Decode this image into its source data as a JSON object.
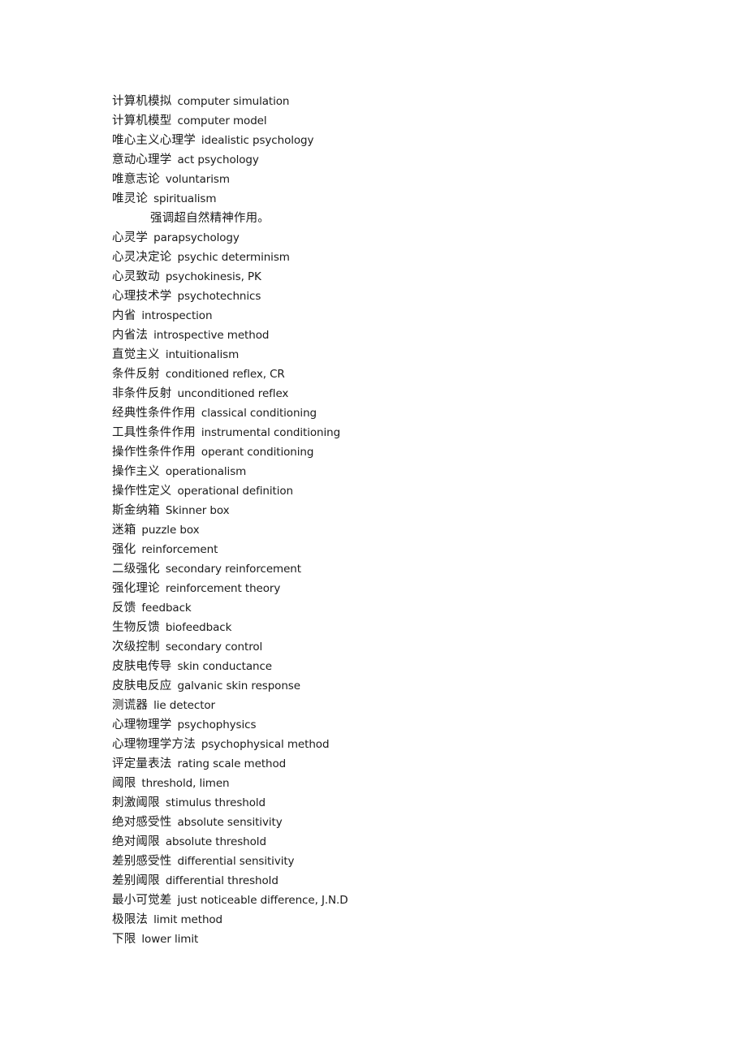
{
  "document": {
    "type": "glossary",
    "language": "zh-CN / en",
    "subject": "psychology-terminology-list",
    "background_color": "#ffffff",
    "text_color": "#1a1a1a"
  },
  "entries": [
    {
      "term": "计算机模拟",
      "gloss": "computer simulation",
      "note": false
    },
    {
      "term": "计算机模型",
      "gloss": "computer model",
      "note": false
    },
    {
      "term": "唯心主义心理学",
      "gloss": "idealistic psychology",
      "note": false
    },
    {
      "term": "意动心理学",
      "gloss": "act psychology",
      "note": false
    },
    {
      "term": "唯意志论",
      "gloss": "voluntarism",
      "note": false
    },
    {
      "term": "唯灵论",
      "gloss": "spiritualism",
      "note": false
    },
    {
      "term": "强调超自然精神作用。",
      "gloss": "",
      "note": true
    },
    {
      "term": "心灵学",
      "gloss": "parapsychology",
      "note": false
    },
    {
      "term": "心灵决定论",
      "gloss": "psychic determinism",
      "note": false
    },
    {
      "term": "心灵致动",
      "gloss": "psychokinesis, PK",
      "note": false
    },
    {
      "term": "心理技术学",
      "gloss": "psychotechnics",
      "note": false
    },
    {
      "term": "内省",
      "gloss": "introspection",
      "note": false
    },
    {
      "term": "内省法",
      "gloss": "introspective method",
      "note": false
    },
    {
      "term": "直觉主义",
      "gloss": "intuitionalism",
      "note": false
    },
    {
      "term": "条件反射",
      "gloss": "conditioned reflex, CR",
      "note": false
    },
    {
      "term": "非条件反射",
      "gloss": "unconditioned reflex",
      "note": false
    },
    {
      "term": "经典性条件作用",
      "gloss": "classical conditioning",
      "note": false
    },
    {
      "term": "工具性条件作用",
      "gloss": "instrumental conditioning",
      "note": false
    },
    {
      "term": "操作性条件作用",
      "gloss": "operant conditioning",
      "note": false
    },
    {
      "term": "操作主义",
      "gloss": "operationalism",
      "note": false
    },
    {
      "term": "操作性定义",
      "gloss": "operational definition",
      "note": false
    },
    {
      "term": "斯金纳箱",
      "gloss": "Skinner box",
      "note": false
    },
    {
      "term": "迷箱",
      "gloss": "puzzle box",
      "note": false
    },
    {
      "term": "强化",
      "gloss": "reinforcement",
      "note": false
    },
    {
      "term": "二级强化",
      "gloss": "secondary reinforcement",
      "note": false
    },
    {
      "term": "强化理论",
      "gloss": "reinforcement theory",
      "note": false
    },
    {
      "term": "反馈",
      "gloss": "feedback",
      "note": false
    },
    {
      "term": "生物反馈",
      "gloss": "biofeedback",
      "note": false
    },
    {
      "term": "次级控制",
      "gloss": "secondary control",
      "note": false
    },
    {
      "term": "皮肤电传导",
      "gloss": "skin conductance",
      "note": false
    },
    {
      "term": "皮肤电反应",
      "gloss": "galvanic skin response",
      "note": false
    },
    {
      "term": "测谎器",
      "gloss": "lie detector",
      "note": false
    },
    {
      "term": "心理物理学",
      "gloss": "psychophysics",
      "note": false
    },
    {
      "term": "心理物理学方法",
      "gloss": "psychophysical method",
      "note": false
    },
    {
      "term": "评定量表法",
      "gloss": "rating scale method",
      "note": false
    },
    {
      "term": "阈限",
      "gloss": "threshold, limen",
      "note": false
    },
    {
      "term": "刺激阈限",
      "gloss": "stimulus threshold",
      "note": false
    },
    {
      "term": "绝对感受性",
      "gloss": "absolute sensitivity",
      "note": false
    },
    {
      "term": "绝对阈限",
      "gloss": "absolute threshold",
      "note": false
    },
    {
      "term": "差别感受性",
      "gloss": "differential sensitivity",
      "note": false
    },
    {
      "term": "差别阈限",
      "gloss": "differential threshold",
      "note": false
    },
    {
      "term": "最小可觉差",
      "gloss": "just noticeable difference, J.N.D",
      "note": false
    },
    {
      "term": "极限法",
      "gloss": "limit method",
      "note": false
    },
    {
      "term": "下限",
      "gloss": "lower limit",
      "note": false
    }
  ]
}
